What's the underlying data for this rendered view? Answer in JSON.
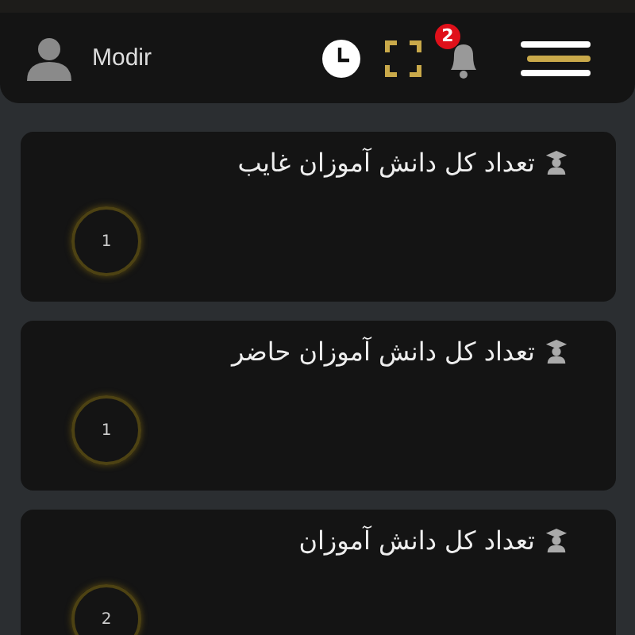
{
  "header": {
    "user_name": "Modir",
    "notification_count": "2"
  },
  "cards": [
    {
      "title": "تعداد کل دانش آموزان غایب",
      "value": "1"
    },
    {
      "title": "تعداد کل دانش آموزان حاضر",
      "value": "1"
    },
    {
      "title": "تعداد کل دانش آموزان",
      "value": "2"
    }
  ]
}
